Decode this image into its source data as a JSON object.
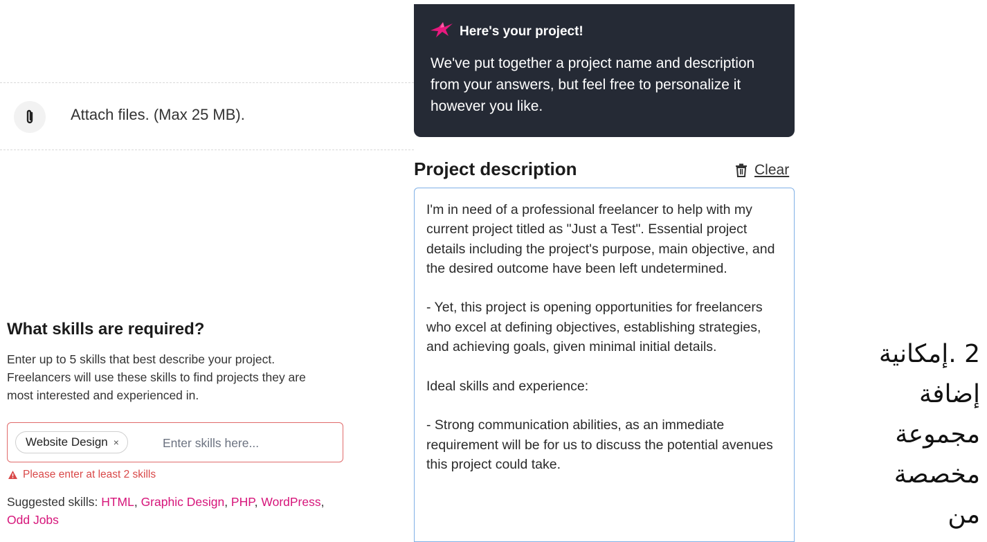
{
  "attach": {
    "icon": "paperclip-icon",
    "label": "Attach files. (Max 25 MB)."
  },
  "skills": {
    "title": "What skills are required?",
    "description": "Enter up to 5 skills that best describe your project. Freelancers will use these skills to find projects they are most interested and experienced in.",
    "selected_chip": "Website Design",
    "chip_remove": "×",
    "input_placeholder": "Enter skills here...",
    "error_icon": "warning-icon",
    "error": "Please enter at least 2 skills",
    "suggested_label": "Suggested skills: ",
    "suggested": [
      "HTML",
      "Graphic Design",
      "PHP",
      "WordPress",
      "Odd Jobs"
    ],
    "colors": {
      "error": "#d94848",
      "link": "#d6157a"
    }
  },
  "banner": {
    "icon": "hummingbird-icon",
    "title": "Here's your project!",
    "text": "We've put together a project name and description from your answers, but feel free to personalize it however you like.",
    "background": "#252a35"
  },
  "description": {
    "title": "Project description",
    "clear_icon": "trash-icon",
    "clear_label": "Clear",
    "text": "I'm in need of a professional freelancer to help with my current project titled as \"Just a Test\". Essential project details including the project's purpose, main objective, and the desired outcome have been left undetermined.\n\n- Yet, this project is opening opportunities for freelancers who excel at defining objectives, establishing strategies, and achieving goals, given minimal initial details.\n\nIdeal skills and experience:\n\n- Strong communication abilities, as an immediate requirement will be for us to discuss the potential avenues this project could take."
  },
  "annotation": {
    "text": "2 .إمكانية إضافة مجموعة مخصصة من"
  }
}
